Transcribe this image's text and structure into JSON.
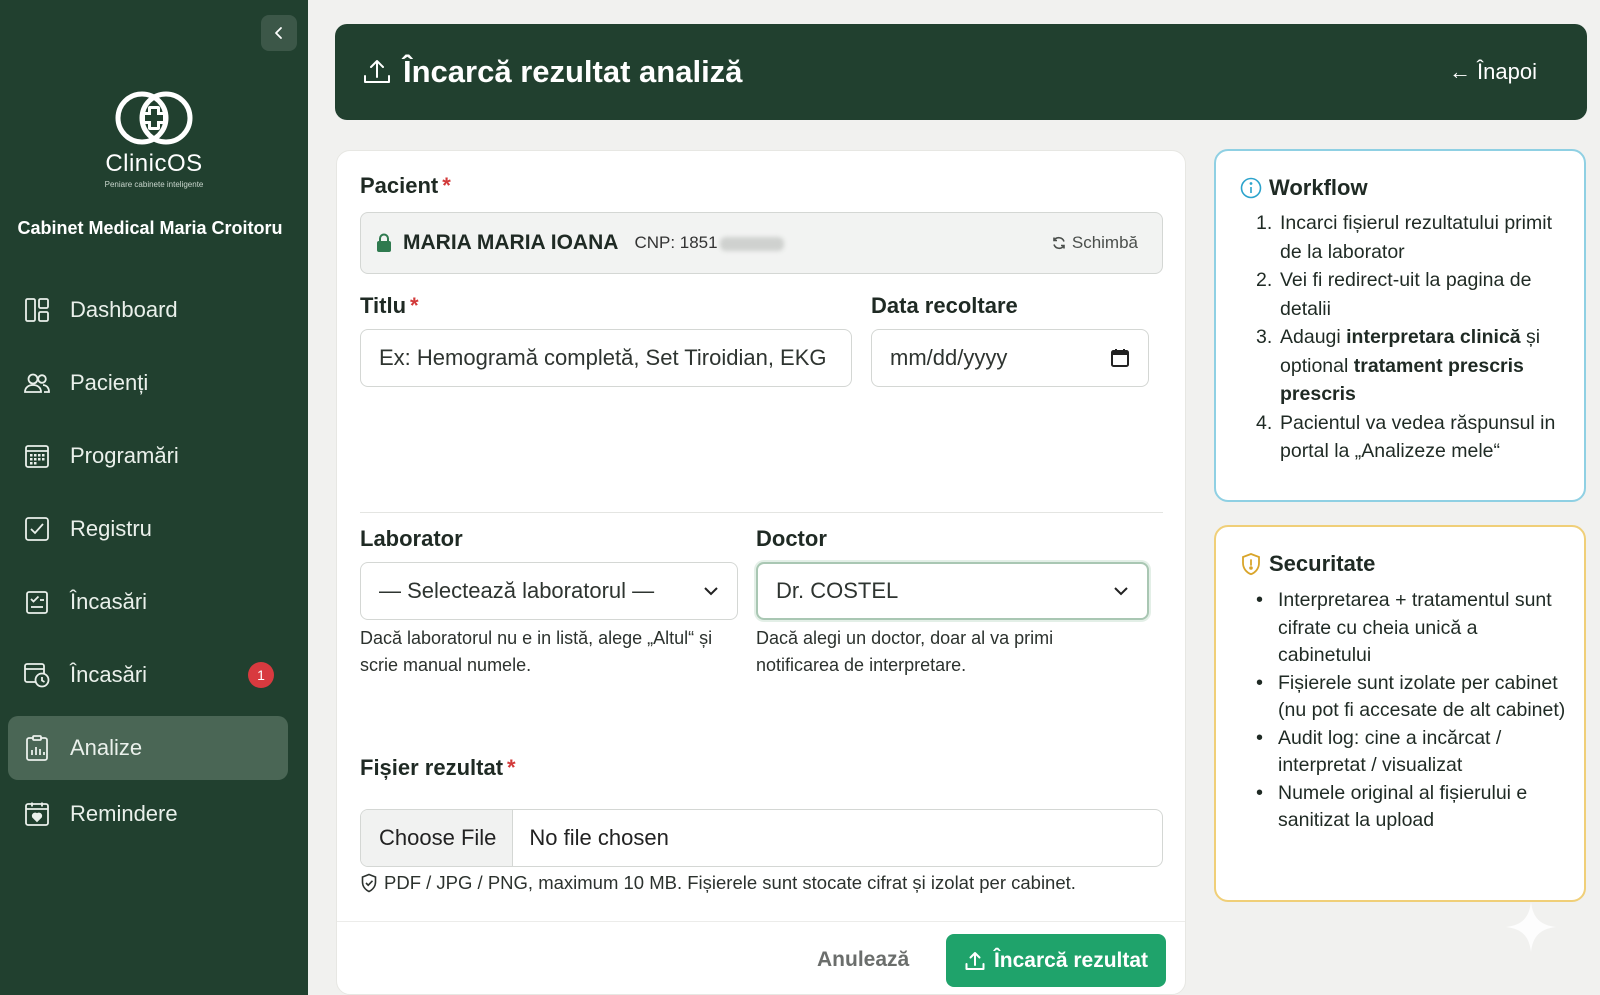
{
  "app": {
    "name": "ClinicOS",
    "tagline": "Peniare cabinete inteligente",
    "cabinet": "Cabinet Medical Maria Croitoru"
  },
  "sidebar": {
    "items": [
      {
        "label": "Dashboard",
        "icon": "dashboard-icon"
      },
      {
        "label": "Pacienți",
        "icon": "users-icon"
      },
      {
        "label": "Programări",
        "icon": "calendar-icon"
      },
      {
        "label": "Registru",
        "icon": "checkbox-icon"
      },
      {
        "label": "Încasări",
        "icon": "checklist-icon"
      },
      {
        "label": "Încasări",
        "icon": "calendar-clock-icon",
        "badge": "1"
      },
      {
        "label": "Analize",
        "icon": "clipboard-chart-icon",
        "active": true
      },
      {
        "label": "Remindere",
        "icon": "calendar-heart-icon"
      }
    ]
  },
  "header": {
    "title": "Încarcă rezultat analiză",
    "back": "Înapoi"
  },
  "form": {
    "patient_label": "Pacient",
    "patient_name": "MARIA MARIA IOANA",
    "patient_cnp": "CNP: 1851",
    "change": "Schimbă",
    "title_label": "Titlu",
    "title_placeholder": "Ex: Hemogramă completă, Set Tiroidian, EKG",
    "date_label": "Data recoltare",
    "date_placeholder": "mm/dd/yyyy",
    "lab_label": "Laborator",
    "lab_value": "— Selectează laboratorul —",
    "lab_help": "Dacă laboratorul nu e in listă, alege „Altul“ și scrie manual numele.",
    "doctor_label": "Doctor",
    "doctor_value": "Dr. COSTEL",
    "doctor_help": "Dacă alegi un doctor, doar al va primi notificarea de interpretare.",
    "file_label": "Fișier rezultat",
    "file_button": "Choose File",
    "file_status": "No file chosen",
    "file_note": "PDF / JPG / PNG, maximum 10 MB. Fișierele sunt stocate cifrat și izolat per cabinet.",
    "cancel": "Anulează",
    "submit": "Încarcă rezultat"
  },
  "workflow": {
    "title": "Workflow",
    "steps": [
      {
        "num": "1.",
        "text": "Incarci fișierul rezultatului primit de la laborator"
      },
      {
        "num": "2.",
        "text": "Vei fi redirect-uit la pagina de detalii"
      },
      {
        "num": "3.",
        "pre": "Adaugi ",
        "b1": "interpretara clinică",
        "mid": " și optional ",
        "b2": "tratament prescris prescris"
      },
      {
        "num": "4.",
        "text": "Pacientul va vedea răspunsul in portal la „Analizeze mele“"
      }
    ]
  },
  "security": {
    "title": "Securitate",
    "items": [
      "Interpretarea + tratamentul sunt cifrate cu cheia unică a cabinetului",
      "Fișierele sunt izolate per cabinet (nu pot fi accesate de alt cabinet)",
      "Audit log: cine a incărcat / interpretat / visualizat",
      "Numele original al fișierului e sanitizat la upload"
    ]
  },
  "colors": {
    "sidebar": "#21402f",
    "active": "#4a6655",
    "accent": "#1fa36b",
    "badge": "#d83a3f",
    "info_border": "#8fd0e3",
    "security_border": "#f0cf78"
  }
}
